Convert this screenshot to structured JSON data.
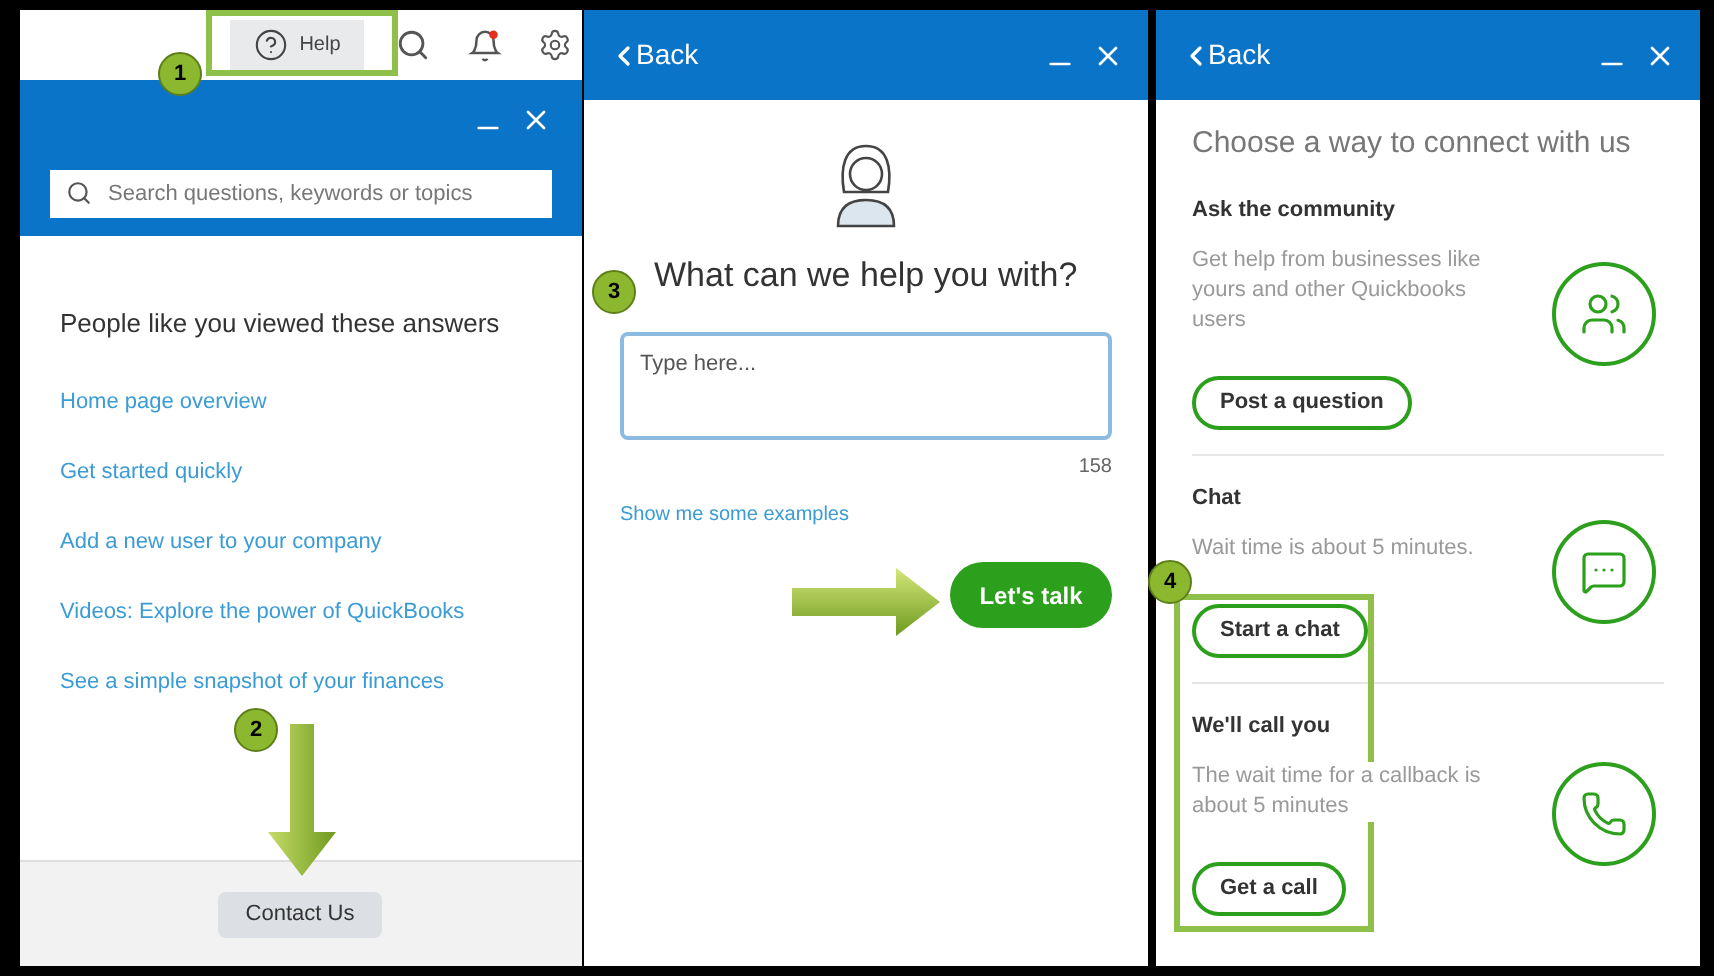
{
  "help_panel": {
    "toolbar": {
      "help_button": "Help"
    },
    "search": {
      "placeholder": "Search questions, keywords or topics"
    },
    "heading": "People like you viewed these answers",
    "links": [
      "Home page overview",
      "Get started quickly",
      "Add a new user to your company",
      "Videos: Explore the power of QuickBooks",
      "See a simple snapshot of your finances"
    ],
    "contact_button": "Contact Us"
  },
  "ask_panel": {
    "back": "Back",
    "heading": "What can we help you with?",
    "question": {
      "placeholder": "Type here..."
    },
    "char_count": "158",
    "examples_link": "Show me some examples",
    "talk_button": "Let's talk"
  },
  "connect_panel": {
    "back": "Back",
    "title": "Choose a way to connect with us",
    "options": [
      {
        "kind": "community",
        "title": "Ask the community",
        "description": "Get help from businesses like yours and other Quickbooks users",
        "button": "Post a question"
      },
      {
        "kind": "chat",
        "title": "Chat",
        "description": "Wait time is about 5 minutes.",
        "button": "Start a chat"
      },
      {
        "kind": "call",
        "title": "We'll call you",
        "description": "The wait time for a callback is about 5 minutes",
        "button": "Get a call"
      }
    ]
  },
  "callouts": [
    {
      "label": "1"
    },
    {
      "label": "2"
    },
    {
      "label": "3"
    },
    {
      "label": "4"
    }
  ]
}
